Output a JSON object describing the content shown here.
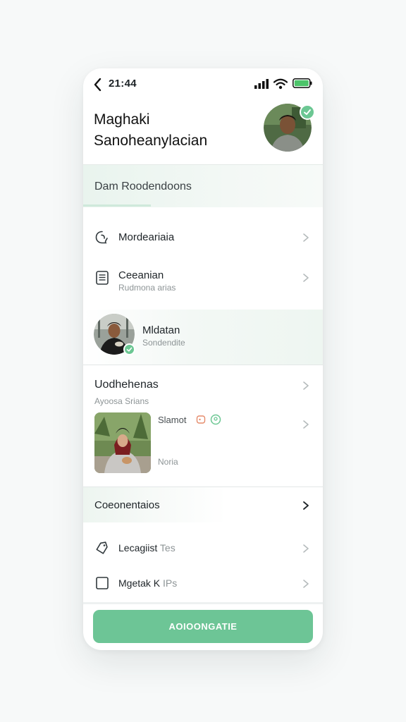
{
  "status_bar": {
    "time": "21:44"
  },
  "profile": {
    "name_line1": "Maghaki",
    "name_line2": "Sanoheanylacian"
  },
  "banner": {
    "label": "Dam Roodendoons"
  },
  "list1": [
    {
      "title": "Mordeariaia",
      "icon": "chat-bubble-icon"
    },
    {
      "title": "Ceeanian",
      "subtitle": "Rudmona arias",
      "icon": "document-icon"
    },
    {
      "title": "Mldatan",
      "subtitle": "Sondendite",
      "icon": "avatar"
    }
  ],
  "group": {
    "title": "Uodhehenas",
    "subtitle": "Ayoosa Srians",
    "media_label": "Slamot",
    "media_sub": "Noria"
  },
  "settings": {
    "header": "Coeonentaios",
    "items": [
      {
        "title": "Lecagiist",
        "suffix": "Tes",
        "icon": "tag-icon"
      },
      {
        "title": "Mgetak K",
        "suffix": "IPs",
        "icon": "checkbox-icon"
      }
    ]
  },
  "cta": {
    "label": "AOIOONGATIE"
  },
  "colors": {
    "accent": "#6dc596",
    "banner": "#e9f4ee"
  }
}
